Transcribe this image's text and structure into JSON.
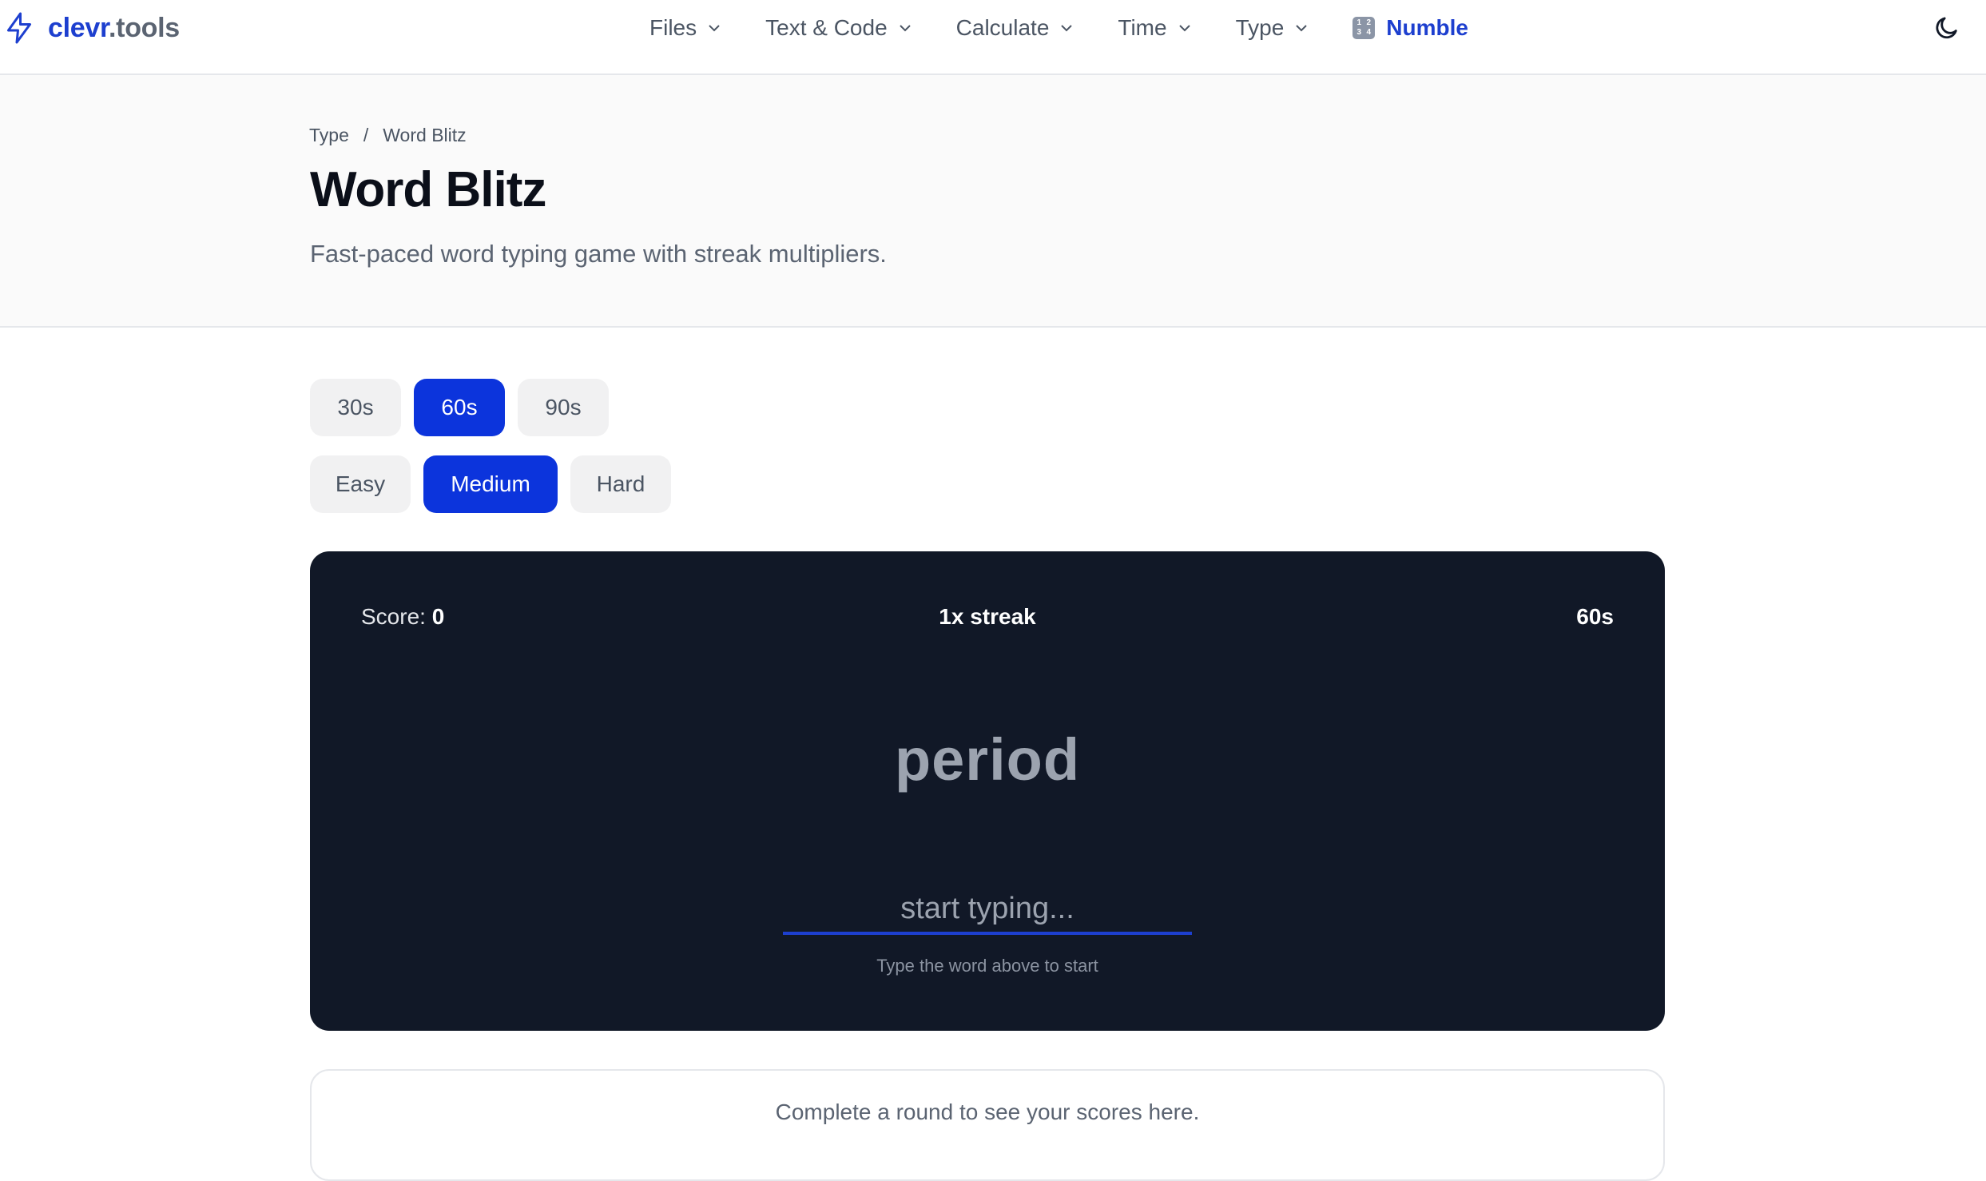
{
  "header": {
    "logo_primary": "clevr",
    "logo_secondary": ".tools",
    "nav": [
      {
        "label": "Files"
      },
      {
        "label": "Text & Code"
      },
      {
        "label": "Calculate"
      },
      {
        "label": "Time"
      },
      {
        "label": "Type"
      }
    ],
    "featured": {
      "label": "Numble",
      "icon": "numble-icon"
    },
    "theme_toggle_icon": "moon-icon"
  },
  "breadcrumb": {
    "parent": "Type",
    "separator": "/",
    "current": "Word Blitz"
  },
  "page": {
    "title": "Word Blitz",
    "subtitle": "Fast-paced word typing game with streak multipliers."
  },
  "durations": {
    "options": [
      "30s",
      "60s",
      "90s"
    ],
    "selected": "60s"
  },
  "difficulties": {
    "options": [
      "Easy",
      "Medium",
      "Hard"
    ],
    "selected": "Medium"
  },
  "game": {
    "score_label": "Score:",
    "score_value": "0",
    "streak": "1x streak",
    "time_left": "60s",
    "current_word": "period",
    "input_value": "",
    "input_placeholder": "start typing...",
    "hint": "Type the word above to start"
  },
  "scores": {
    "empty_message": "Complete a round to see your scores here."
  },
  "colors": {
    "accent": "#0c34dc",
    "brand": "#1d3fcf",
    "panel": "#111827"
  }
}
